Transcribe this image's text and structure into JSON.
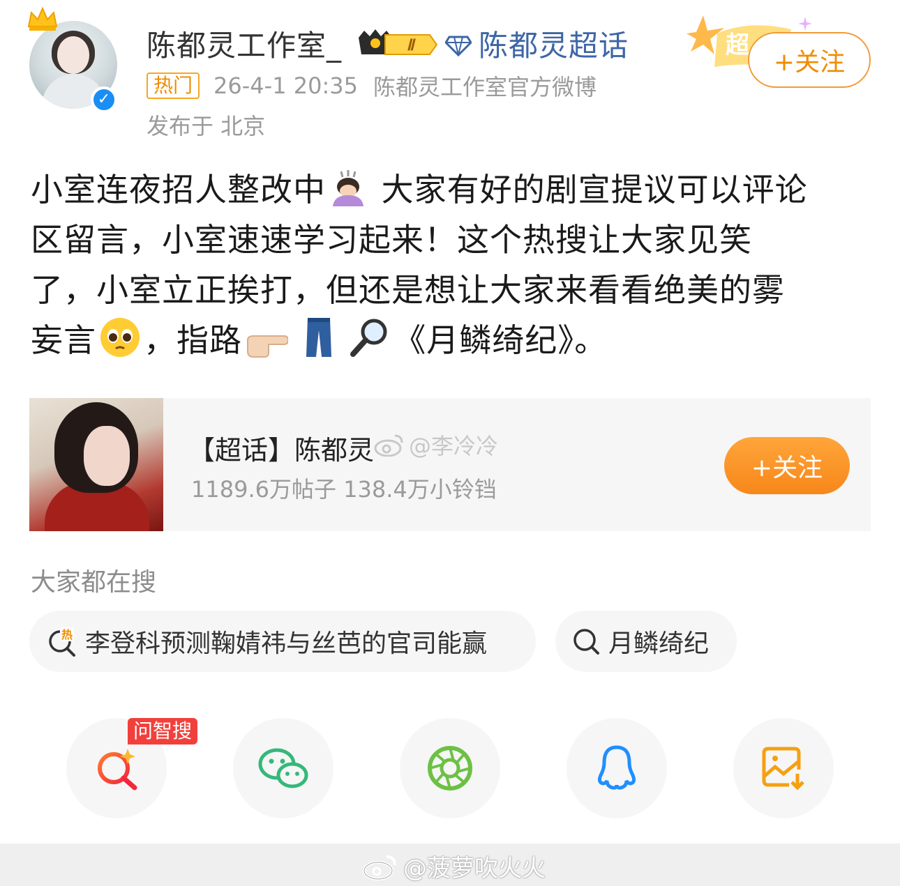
{
  "header": {
    "user_name": "陈都灵工作室_",
    "level": "Ⅱ",
    "topic_link": "陈都灵超话",
    "hot_tag": "热门",
    "timestamp": "26-4-1 20:35",
    "source": "陈都灵工作室官方微博",
    "location": "发布于 北京",
    "chao_decor": "超",
    "follow_label": "+关注"
  },
  "post": {
    "line1": "小室连夜招人整改中",
    "line1b": "大家有好的剧宣提议可以评论",
    "line2": "区留言，小室速速学习起来！这个热搜让大家见笑",
    "line3": "了，小室立正挨打，但还是想让大家来看看绝美的雾",
    "line4a": "妄言",
    "line4b": "，指路",
    "line4c": "《月鳞绮纪》。"
  },
  "card": {
    "title": "【超话】陈都灵",
    "subtitle": "1189.6万帖子 138.4万小铃铛",
    "watermark": "@李冷冷",
    "follow_label": "+关注"
  },
  "searches": {
    "title": "大家都在搜",
    "items": [
      {
        "label": "李登科预测鞠婧祎与丝芭的官司能赢",
        "icon": "hot-search-icon"
      },
      {
        "label": "月鳞绮纪",
        "icon": "search-icon"
      }
    ]
  },
  "share": {
    "ai_badge": "问智搜",
    "items": [
      "ai-search-icon",
      "wechat-icon",
      "moments-icon",
      "qq-icon",
      "save-image-icon"
    ]
  },
  "footer": {
    "watermark": "@菠萝吹火火"
  },
  "colors": {
    "accent_orange": "#f7871a",
    "link_blue": "#3d66a6",
    "verified_blue": "#1a8ef5",
    "ai_red": "#f1403c"
  }
}
